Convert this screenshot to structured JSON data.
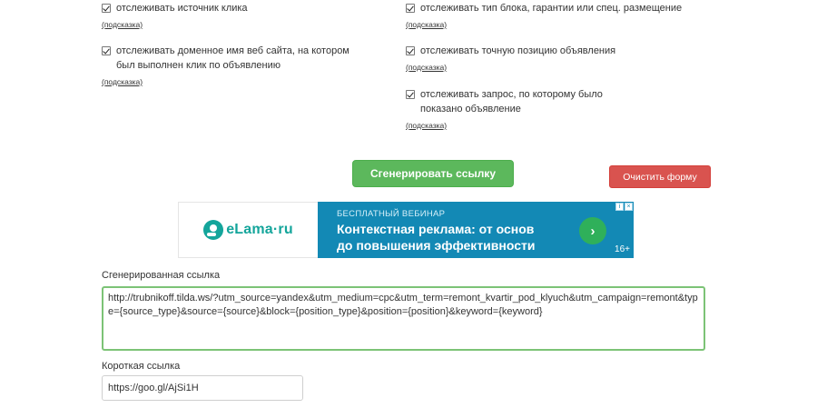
{
  "options_left": [
    {
      "label": "отслеживать источник клика",
      "hint": "(подсказка)"
    },
    {
      "label": "отслеживать доменное имя веб сайта, на котором был выполнен клик по объявлению",
      "hint": "(подсказка)"
    }
  ],
  "options_right": [
    {
      "label": "отслеживать тип блока, гарантии или спец. размещение",
      "hint": "(подсказка)"
    },
    {
      "label": "отслеживать точную позицию объявления",
      "hint": "(подсказка)"
    },
    {
      "label": "отслеживать запрос, по которому было показано объявление",
      "hint": "(подсказка)"
    }
  ],
  "buttons": {
    "generate": "Сгенерировать ссылку",
    "clear": "Очистить форму"
  },
  "ad": {
    "logo": "eLama·ru",
    "subtitle": "БЕСПЛАТНЫЙ ВЕБИНАР",
    "title_line1": "Контекстная реклама: от основ",
    "title_line2": "до повышения эффективности",
    "arrow": "›",
    "age": "16+",
    "badge_info": "i",
    "badge_close": "×",
    "colors": {
      "banner": "#1389b5",
      "arrow": "#2fb05a",
      "logo": "#14a59b"
    }
  },
  "generated": {
    "label": "Сгенерированная ссылка",
    "value": "http://trubnikoff.tilda.ws/?utm_source=yandex&utm_medium=cpc&utm_term=remont_kvartir_pod_klyuch&utm_campaign=remont&type={source_type}&source={source}&block={position_type}&position={position}&keyword={keyword}"
  },
  "short_link": {
    "label": "Короткая ссылка",
    "value": "https://goo.gl/AjSi1H"
  },
  "colors": {
    "green_button": "#5cb85c",
    "red_button": "#d9534f",
    "textarea_border": "#7cc376"
  }
}
